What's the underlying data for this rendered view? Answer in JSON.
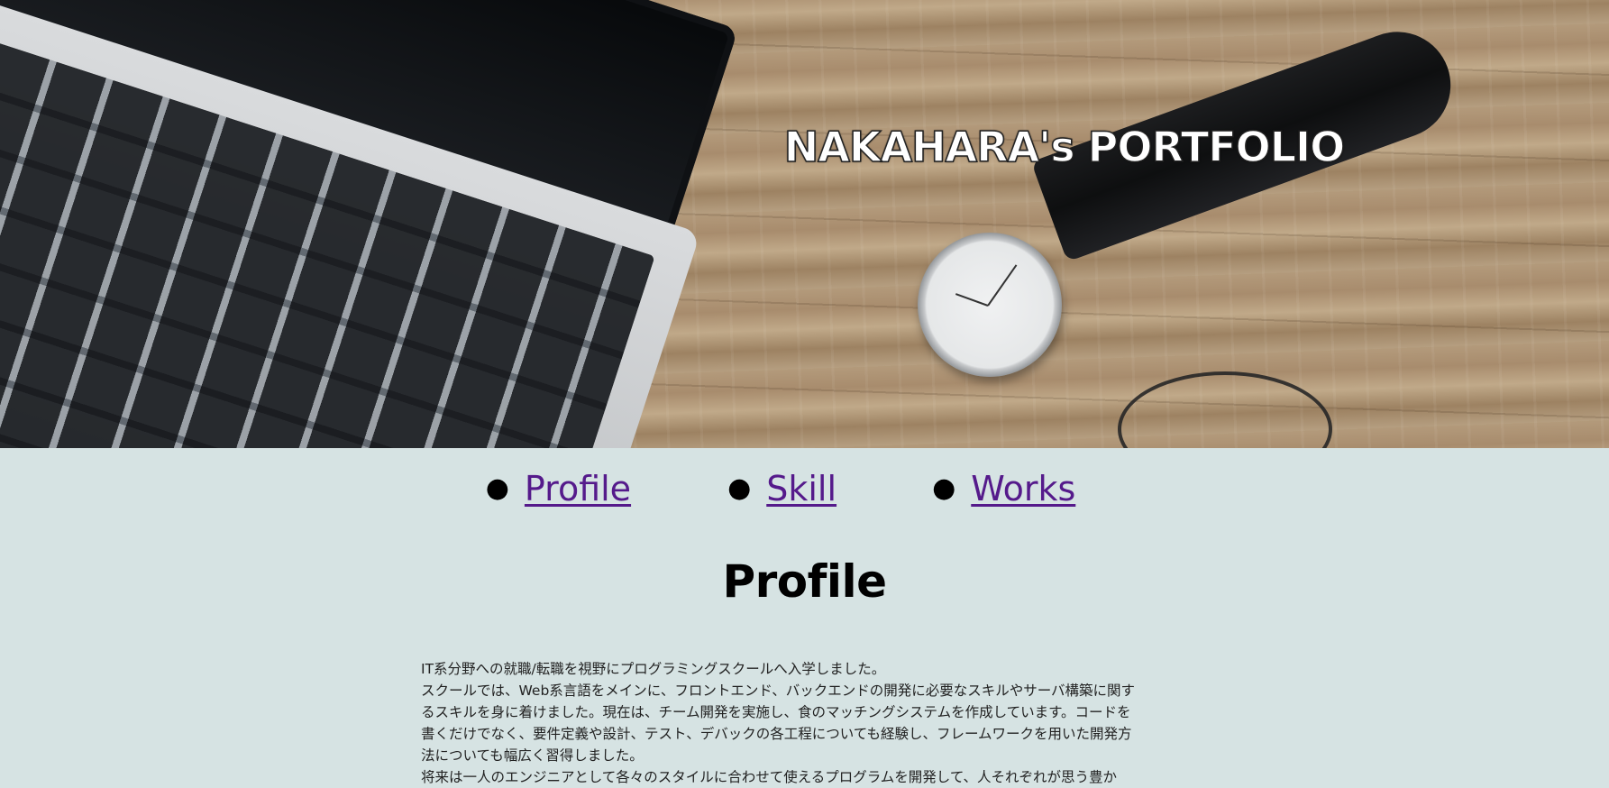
{
  "hero": {
    "title": "NAKAHARA's PORTFOLIO",
    "image_description_icon": "desk-photo"
  },
  "nav": {
    "items": [
      {
        "label": "Profile"
      },
      {
        "label": "Skill"
      },
      {
        "label": "Works"
      }
    ]
  },
  "profile": {
    "heading": "Profile",
    "paragraphs": [
      "IT系分野への就職/転職を視野にプログラミングスクールへ入学しました。",
      "スクールでは、Web系言語をメインに、フロントエンド、バックエンドの開発に必要なスキルやサーバ構築に関するスキルを身に着けました。現在は、チーム開発を実施し、食のマッチングシステムを作成しています。コードを書くだけでなく、要件定義や設計、テスト、デバックの各工程についても経験し、フレームワークを用いた開発方法についても幅広く習得しました。",
      "将来は一人のエンジニアとして各々のスタイルに合わせて使えるプログラムを開発して、人それぞれが思う豊か"
    ]
  },
  "colors": {
    "page_background": "#d6e3e3",
    "link": "#551a8b"
  }
}
